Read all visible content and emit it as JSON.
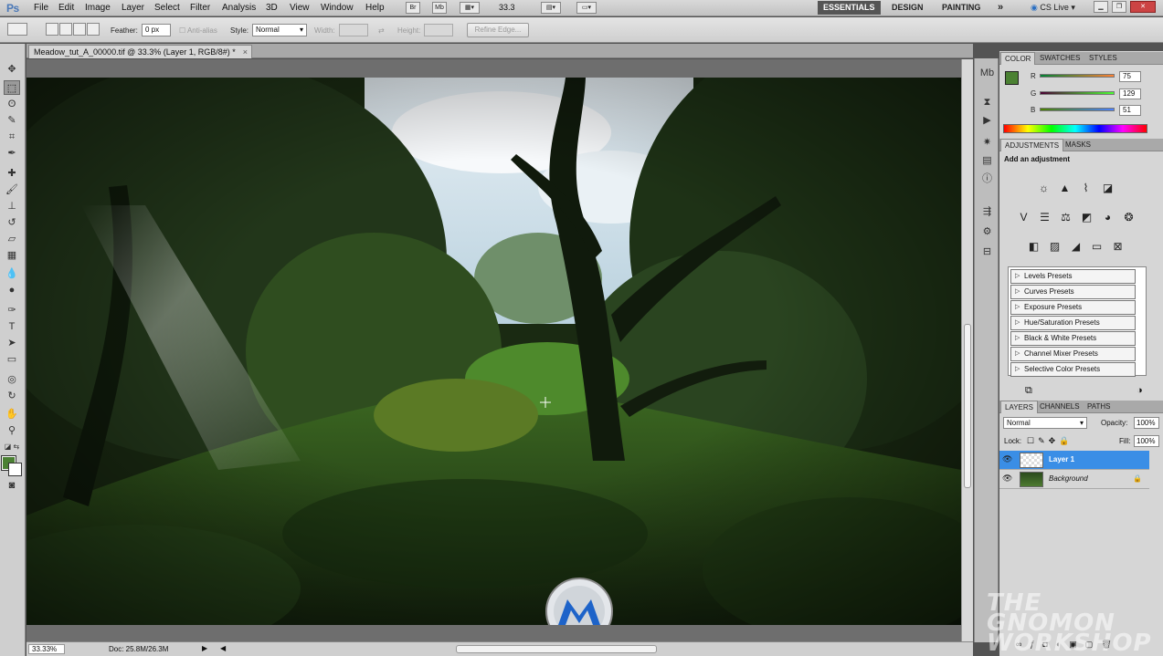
{
  "menubar": {
    "logo": "Ps",
    "items": [
      "File",
      "Edit",
      "Image",
      "Layer",
      "Select",
      "Filter",
      "Analysis",
      "3D",
      "View",
      "Window",
      "Help"
    ],
    "bridge_btn": "Br",
    "minibridge_btn": "Mb",
    "zoom": "33.3",
    "workspaces": [
      "ESSENTIALS",
      "DESIGN",
      "PAINTING"
    ],
    "more": "»",
    "cslive": "CS Live"
  },
  "options": {
    "feather_label": "Feather:",
    "feather_value": "0 px",
    "antialias_label": "Anti-alias",
    "style_label": "Style:",
    "style_value": "Normal",
    "width_label": "Width:",
    "height_label": "Height:",
    "refine_label": "Refine Edge..."
  },
  "document": {
    "tab_title": "Meadow_tut_A_00000.tif @ 33.3% (Layer 1, RGB/8#) *",
    "close": "×",
    "zoom": "33.33%",
    "doc_info": "Doc: 25.8M/26.3M"
  },
  "color_panel": {
    "tabs": [
      "COLOR",
      "SWATCHES",
      "STYLES"
    ],
    "r_label": "R",
    "g_label": "G",
    "b_label": "B",
    "r": "75",
    "g": "129",
    "b": "51",
    "fg_color": "#4b8133"
  },
  "adjustments_panel": {
    "tabs": [
      "ADJUSTMENTS",
      "MASKS"
    ],
    "heading": "Add an adjustment",
    "presets": [
      "Levels Presets",
      "Curves Presets",
      "Exposure Presets",
      "Hue/Saturation Presets",
      "Black & White Presets",
      "Channel Mixer Presets",
      "Selective Color Presets"
    ]
  },
  "layers_panel": {
    "tabs": [
      "LAYERS",
      "CHANNELS",
      "PATHS"
    ],
    "blend_mode": "Normal",
    "opacity_label": "Opacity:",
    "opacity": "100%",
    "lock_label": "Lock:",
    "fill_label": "Fill:",
    "fill": "100%",
    "layers": [
      {
        "name": "Layer 1",
        "selected": true
      },
      {
        "name": "Background",
        "selected": false
      }
    ]
  },
  "watermark": {
    "line1": "THE GNOMON",
    "line2": "WORKSHOP"
  }
}
